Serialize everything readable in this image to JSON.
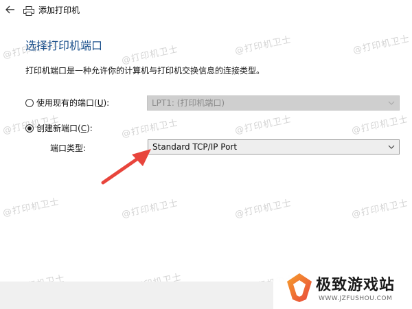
{
  "titlebar": {
    "title": "添加打印机",
    "back_icon": "back-arrow-icon",
    "printer_icon": "printer-icon"
  },
  "heading": "选择打印机端口",
  "description": "打印机端口是一种允许你的计算机与打印机交换信息的连接类型。",
  "existing_port": {
    "label_before": "使用现有的端口(",
    "hotkey": "U",
    "label_after": "):",
    "checked": false,
    "select_value": "LPT1: (打印机端口)",
    "disabled": true
  },
  "new_port": {
    "label_before": "创建新端口(",
    "hotkey": "C",
    "label_after": "):",
    "checked": true
  },
  "port_type": {
    "label": "端口类型:",
    "select_value": "Standard TCP/IP Port"
  },
  "watermark_text": "@打印机卫士",
  "branding": {
    "logo_text": "极致游戏站",
    "url": "WWW.JZFUSHOU.COM"
  },
  "colors": {
    "heading": "#1a4f8b",
    "arrow": "#e8453c"
  }
}
